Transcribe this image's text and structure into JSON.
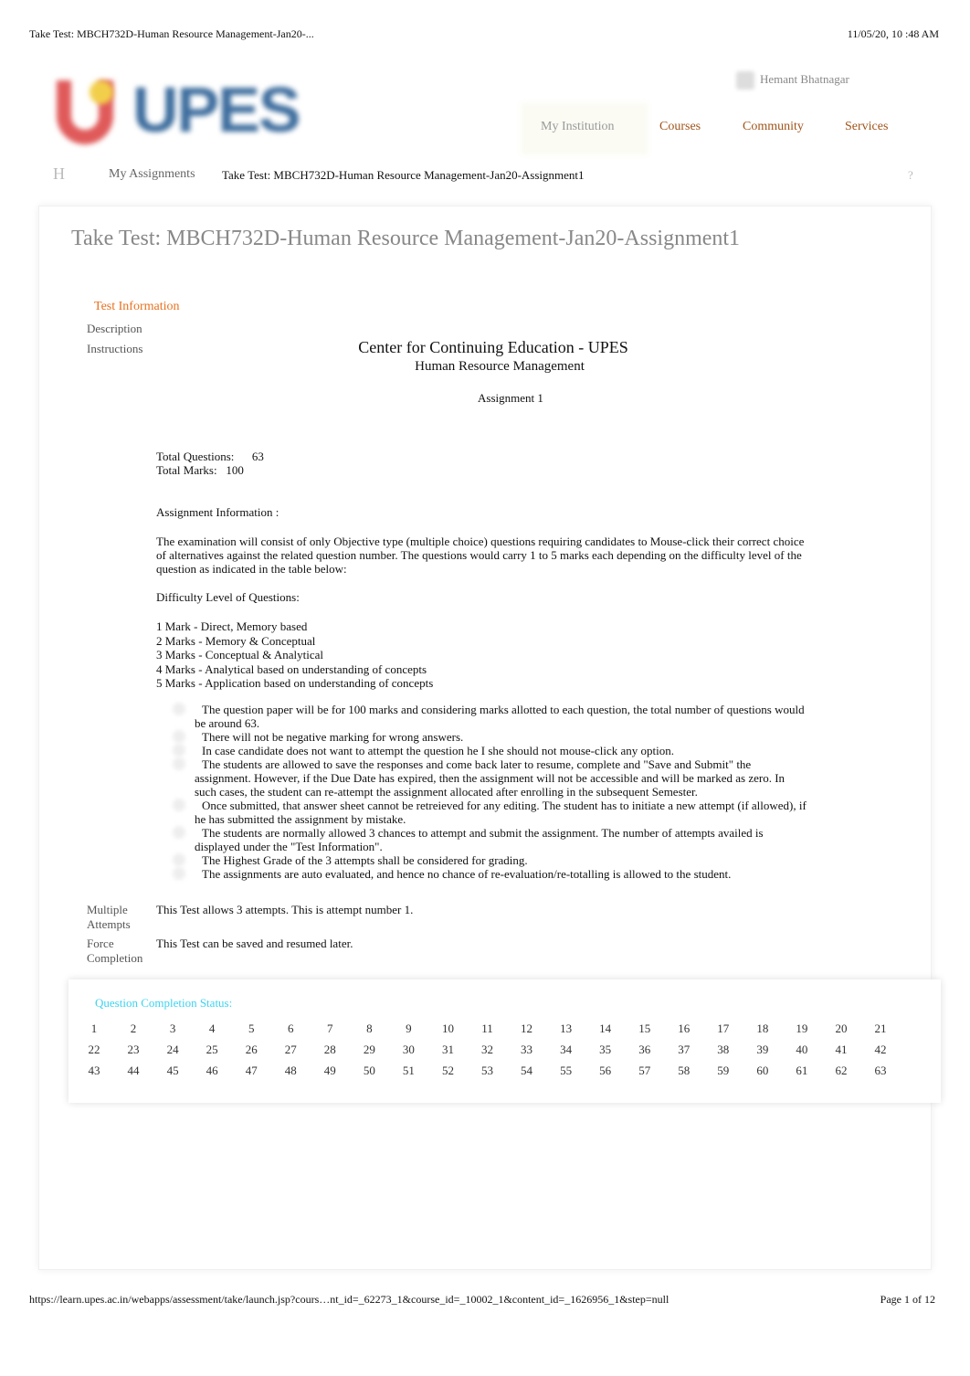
{
  "print_header": {
    "title": "Take Test: MBCH732D-Human Resource Management-Jan20-...",
    "datetime": "11/05/20, 10  :48 AM"
  },
  "logo": {
    "text": "UPES"
  },
  "user": {
    "name": "Hemant Bhatnagar"
  },
  "nav": {
    "tabs": [
      {
        "label": "My Institution",
        "active": true
      },
      {
        "label": "Courses"
      },
      {
        "label": "Community"
      },
      {
        "label": "Services"
      }
    ]
  },
  "breadcrumb": {
    "home": "H",
    "items": [
      "My Assignments",
      "Take Test: MBCH732D-Human Resource Management-Jan20-Assignment1"
    ],
    "help": "?"
  },
  "page_title": "Take Test: MBCH732D-Human Resource Management-Jan20-Assignment1",
  "test_info": {
    "heading": "Test Information",
    "description_label": "Description",
    "instructions_label": "Instructions",
    "center": "Center for Continuing Education - UPES",
    "subject": "Human Resource Management",
    "assignment": "Assignment 1",
    "total_questions_label": "Total Questions:",
    "total_questions": "63",
    "total_marks_label": "Total Marks:",
    "total_marks": "100",
    "info_heading": "Assignment Information :",
    "info_text": "The examination will consist of only Objective type (multiple choice) questions requiring candidates to Mouse-click their correct choice of alternatives against the related question number. The questions would carry 1 to 5 marks each depending on the difficulty level of the question as indicated in the table below:",
    "difficulty_heading": "Difficulty Level of Questions:",
    "difficulty": [
      "1 Mark - Direct, Memory based",
      "2 Marks - Memory & Conceptual",
      "3 Marks - Conceptual & Analytical",
      "4 Marks - Analytical based on understanding of concepts",
      "5 Marks - Application based on understanding of concepts"
    ],
    "rules": [
      "The question paper will be for 100 marks and considering marks allotted to each question, the total number of questions would be around 63.",
      "There will not be negative marking for wrong answers.",
      "In case candidate does not want to attempt the question he I she should not mouse-click any option.",
      "The students are allowed to save the responses and come back later to resume, complete and \"Save and Submit\" the assignment. However, if the Due Date has expired, then the assignment will not be accessible and will be marked as zero. In such cases, the student can re-attempt the assignment allocated after enrolling in the subsequent Semester.",
      "Once submitted, that answer sheet cannot be retreieved for any editing. The student has to initiate a new attempt (if allowed), if he has submitted the assignment by mistake.",
      "The students are normally allowed 3 chances to attempt and submit the assignment. The number of attempts availed is displayed under the \"Test Information\".",
      "The Highest Grade of the 3 attempts shall be considered for grading.",
      "The assignments are auto evaluated, and hence no chance of re-evaluation/re-totalling is allowed to the student."
    ],
    "multiple_attempts_label": "Multiple Attempts",
    "multiple_attempts": "This Test allows 3 attempts. This is attempt number 1.",
    "force_completion_label": "Force Completion",
    "force_completion": "This Test can be saved and resumed later."
  },
  "completion": {
    "heading": "Question Completion Status:",
    "question_count": 63
  },
  "print_footer": {
    "url": "https://learn.upes.ac.in/webapps/assessment/take/launch.jsp?cours…nt_id=_62273_1&course_id=_10002_1&content_id=_1626956_1&step=null",
    "page": "Page 1 of 12"
  },
  "colors": {
    "nav_link": "#a0541a",
    "heading_orange": "#e8711f",
    "completion_heading": "#3bd3f0"
  }
}
